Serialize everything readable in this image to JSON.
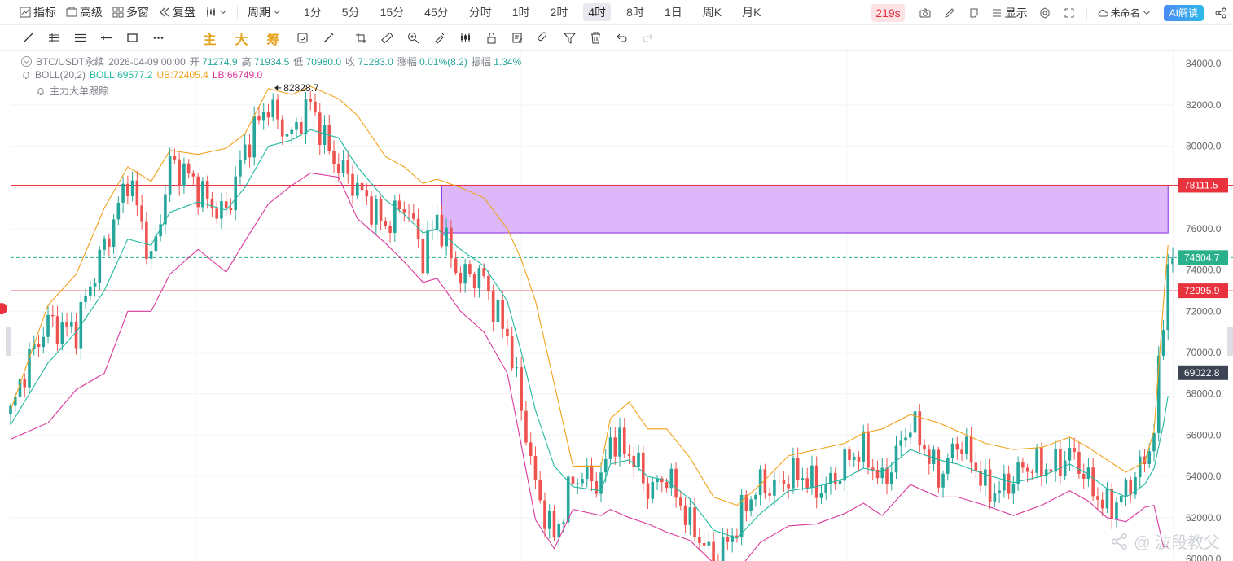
{
  "toolbar": {
    "indicator": "指标",
    "advanced": "高级",
    "multi_window": "多窗",
    "replay": "复盘",
    "period": "周期",
    "periods": [
      "1分",
      "5分",
      "15分",
      "45分",
      "分时",
      "1时",
      "2时",
      "4时",
      "8时",
      "1日",
      "周K",
      "月K"
    ],
    "active_period": "4时",
    "timer": "219s",
    "display": "显示",
    "unnamed": "未命名",
    "ai": "AI解读"
  },
  "drawbar": {
    "zhu": "主",
    "da": "大",
    "chou": "筹"
  },
  "legend": {
    "symbol": "BTC/USDT永续",
    "datetime": "2026-04-09 00:00",
    "open_label": "开",
    "open": "71274.9",
    "high_label": "高",
    "high": "71934.5",
    "low_label": "低",
    "low": "70980.0",
    "close_label": "收",
    "close": "71283.0",
    "change_label": "涨幅",
    "change": "0.01%(8.2)",
    "amp_label": "振幅",
    "amp": "1.34%",
    "boll_name": "BOLL(20,2)",
    "boll": "BOLL:69577.2",
    "ub": "UB:72405.4",
    "lb": "LB:66749.0",
    "tracker": "主力大单跟踪"
  },
  "watermark": "@ 波段教父",
  "colors": {
    "up": "#26a69a",
    "down": "#ef5350",
    "boll_mid": "#21b89f",
    "boll_ub": "#f2a21b",
    "boll_lb": "#d9389b",
    "hline": "#e8333f",
    "rect_fill": "#dcb8fb",
    "rect_stroke": "#8a2be2",
    "current": "#2ab08a",
    "last_label": "#3d4454"
  },
  "chart_data": {
    "type": "candlestick",
    "ylim": [
      59900,
      84600
    ],
    "yticks": [
      60000,
      62000,
      64000,
      66000,
      68000,
      70000,
      72000,
      74000,
      76000,
      78000,
      80000,
      82000,
      84000
    ],
    "ytick_labels": [
      "60000.0",
      "62000.0",
      "64000.0",
      "66000.0",
      "68000.0",
      "70000.0",
      "72000.0",
      "74000.0",
      "76000.0",
      "78000.0",
      "80000.0",
      "82000.0",
      "84000.0"
    ],
    "xlim": [
      0,
      248
    ],
    "close_path": [
      [
        0,
        67000
      ],
      [
        8,
        71800
      ],
      [
        14,
        70800
      ],
      [
        20,
        75500
      ],
      [
        25,
        78300
      ],
      [
        30,
        74400
      ],
      [
        34,
        79400
      ],
      [
        40,
        77700
      ],
      [
        46,
        77000
      ],
      [
        50,
        79500
      ],
      [
        55,
        82300
      ],
      [
        60,
        80300
      ],
      [
        64,
        81900
      ],
      [
        70,
        79200
      ],
      [
        74,
        77600
      ],
      [
        80,
        76500
      ],
      [
        84,
        77100
      ],
      [
        88,
        74500
      ],
      [
        91,
        76900
      ],
      [
        96,
        73400
      ],
      [
        101,
        73600
      ],
      [
        106,
        71000
      ],
      [
        109,
        67000
      ],
      [
        112,
        63400
      ],
      [
        116,
        61400
      ],
      [
        120,
        63600
      ],
      [
        126,
        63900
      ],
      [
        128,
        66200
      ],
      [
        132,
        64900
      ],
      [
        136,
        63300
      ],
      [
        140,
        64400
      ],
      [
        145,
        61300
      ],
      [
        150,
        60200
      ],
      [
        155,
        61500
      ],
      [
        160,
        63600
      ],
      [
        166,
        64000
      ],
      [
        172,
        63400
      ],
      [
        178,
        64600
      ],
      [
        182,
        65000
      ],
      [
        186,
        64000
      ],
      [
        192,
        66300
      ],
      [
        198,
        64300
      ],
      [
        202,
        65600
      ],
      [
        208,
        63500
      ],
      [
        214,
        63800
      ],
      [
        220,
        64600
      ],
      [
        226,
        65000
      ],
      [
        230,
        63500
      ],
      [
        234,
        62800
      ],
      [
        238,
        63100
      ],
      [
        242,
        64500
      ],
      [
        244,
        66500
      ],
      [
        246,
        72000
      ],
      [
        247,
        74600
      ]
    ],
    "boll_mid": [
      [
        0,
        66500
      ],
      [
        8,
        69500
      ],
      [
        14,
        71000
      ],
      [
        20,
        73000
      ],
      [
        25,
        75500
      ],
      [
        30,
        75200
      ],
      [
        34,
        76800
      ],
      [
        40,
        77300
      ],
      [
        46,
        76900
      ],
      [
        50,
        78000
      ],
      [
        55,
        80000
      ],
      [
        60,
        80300
      ],
      [
        64,
        80800
      ],
      [
        70,
        80400
      ],
      [
        74,
        79000
      ],
      [
        80,
        77400
      ],
      [
        84,
        76700
      ],
      [
        88,
        75800
      ],
      [
        91,
        76000
      ],
      [
        96,
        75000
      ],
      [
        101,
        74200
      ],
      [
        106,
        72500
      ],
      [
        109,
        70000
      ],
      [
        112,
        67200
      ],
      [
        116,
        64500
      ],
      [
        120,
        63500
      ],
      [
        126,
        63300
      ],
      [
        128,
        64600
      ],
      [
        132,
        64800
      ],
      [
        136,
        64000
      ],
      [
        140,
        63800
      ],
      [
        145,
        62900
      ],
      [
        150,
        61400
      ],
      [
        155,
        61000
      ],
      [
        160,
        62200
      ],
      [
        166,
        63300
      ],
      [
        172,
        63500
      ],
      [
        178,
        63900
      ],
      [
        182,
        64400
      ],
      [
        186,
        64200
      ],
      [
        192,
        65300
      ],
      [
        198,
        64800
      ],
      [
        202,
        64600
      ],
      [
        208,
        64100
      ],
      [
        214,
        63700
      ],
      [
        220,
        64000
      ],
      [
        226,
        64600
      ],
      [
        230,
        64100
      ],
      [
        234,
        63400
      ],
      [
        238,
        63000
      ],
      [
        242,
        63600
      ],
      [
        244,
        64400
      ],
      [
        246,
        66500
      ],
      [
        247,
        67900
      ]
    ],
    "boll_ub": [
      [
        0,
        67200
      ],
      [
        8,
        72300
      ],
      [
        14,
        73800
      ],
      [
        20,
        77000
      ],
      [
        25,
        79000
      ],
      [
        30,
        78300
      ],
      [
        34,
        79800
      ],
      [
        40,
        79600
      ],
      [
        46,
        79900
      ],
      [
        50,
        80600
      ],
      [
        55,
        82800
      ],
      [
        60,
        82500
      ],
      [
        64,
        82900
      ],
      [
        70,
        82300
      ],
      [
        74,
        81500
      ],
      [
        80,
        79500
      ],
      [
        84,
        79000
      ],
      [
        88,
        78200
      ],
      [
        91,
        78400
      ],
      [
        96,
        78000
      ],
      [
        101,
        77500
      ],
      [
        106,
        76000
      ],
      [
        109,
        74500
      ],
      [
        112,
        72500
      ],
      [
        116,
        68500
      ],
      [
        120,
        64500
      ],
      [
        126,
        64500
      ],
      [
        128,
        66800
      ],
      [
        132,
        67600
      ],
      [
        136,
        66300
      ],
      [
        140,
        66300
      ],
      [
        145,
        64900
      ],
      [
        150,
        63000
      ],
      [
        155,
        62600
      ],
      [
        160,
        63600
      ],
      [
        166,
        65000
      ],
      [
        172,
        65300
      ],
      [
        178,
        65600
      ],
      [
        182,
        66100
      ],
      [
        186,
        66300
      ],
      [
        192,
        67000
      ],
      [
        198,
        66600
      ],
      [
        202,
        66200
      ],
      [
        208,
        65600
      ],
      [
        214,
        65300
      ],
      [
        220,
        65400
      ],
      [
        226,
        65900
      ],
      [
        230,
        65400
      ],
      [
        234,
        64800
      ],
      [
        238,
        64200
      ],
      [
        242,
        64700
      ],
      [
        244,
        66200
      ],
      [
        246,
        72400
      ],
      [
        247,
        75200
      ]
    ],
    "boll_lb": [
      [
        0,
        65800
      ],
      [
        8,
        66600
      ],
      [
        14,
        68200
      ],
      [
        20,
        69000
      ],
      [
        25,
        72000
      ],
      [
        30,
        72000
      ],
      [
        34,
        73800
      ],
      [
        40,
        75000
      ],
      [
        46,
        73900
      ],
      [
        50,
        75400
      ],
      [
        55,
        77200
      ],
      [
        60,
        78100
      ],
      [
        64,
        78700
      ],
      [
        70,
        78500
      ],
      [
        74,
        76500
      ],
      [
        80,
        75300
      ],
      [
        84,
        74400
      ],
      [
        88,
        73400
      ],
      [
        91,
        73600
      ],
      [
        96,
        72000
      ],
      [
        101,
        71000
      ],
      [
        106,
        69000
      ],
      [
        109,
        65500
      ],
      [
        112,
        61900
      ],
      [
        116,
        60500
      ],
      [
        120,
        62400
      ],
      [
        126,
        62100
      ],
      [
        128,
        62400
      ],
      [
        132,
        62000
      ],
      [
        136,
        61700
      ],
      [
        140,
        61300
      ],
      [
        145,
        60900
      ],
      [
        150,
        59800
      ],
      [
        155,
        59400
      ],
      [
        160,
        60800
      ],
      [
        166,
        61600
      ],
      [
        172,
        61700
      ],
      [
        178,
        62200
      ],
      [
        182,
        62700
      ],
      [
        186,
        62100
      ],
      [
        192,
        63600
      ],
      [
        198,
        63000
      ],
      [
        202,
        63000
      ],
      [
        208,
        62600
      ],
      [
        214,
        62100
      ],
      [
        220,
        62600
      ],
      [
        226,
        63300
      ],
      [
        230,
        62800
      ],
      [
        234,
        62000
      ],
      [
        238,
        61800
      ],
      [
        242,
        62500
      ],
      [
        244,
        62600
      ],
      [
        246,
        60600
      ],
      [
        247,
        60600
      ]
    ],
    "hlines": [
      {
        "value": 78111.5,
        "label": "78111.5"
      },
      {
        "value": 72995.9,
        "label": "72995.9"
      }
    ],
    "current_price": {
      "value": 74604.7,
      "label": "74604.7"
    },
    "last_value": {
      "value": 69022.8,
      "label": "69022.8"
    },
    "max_marker": {
      "value": 82828.7,
      "label": "82828.7",
      "x": 56
    },
    "zone": {
      "x0": 92,
      "x1": 247,
      "y0": 75800,
      "y1": 78111.5
    }
  }
}
